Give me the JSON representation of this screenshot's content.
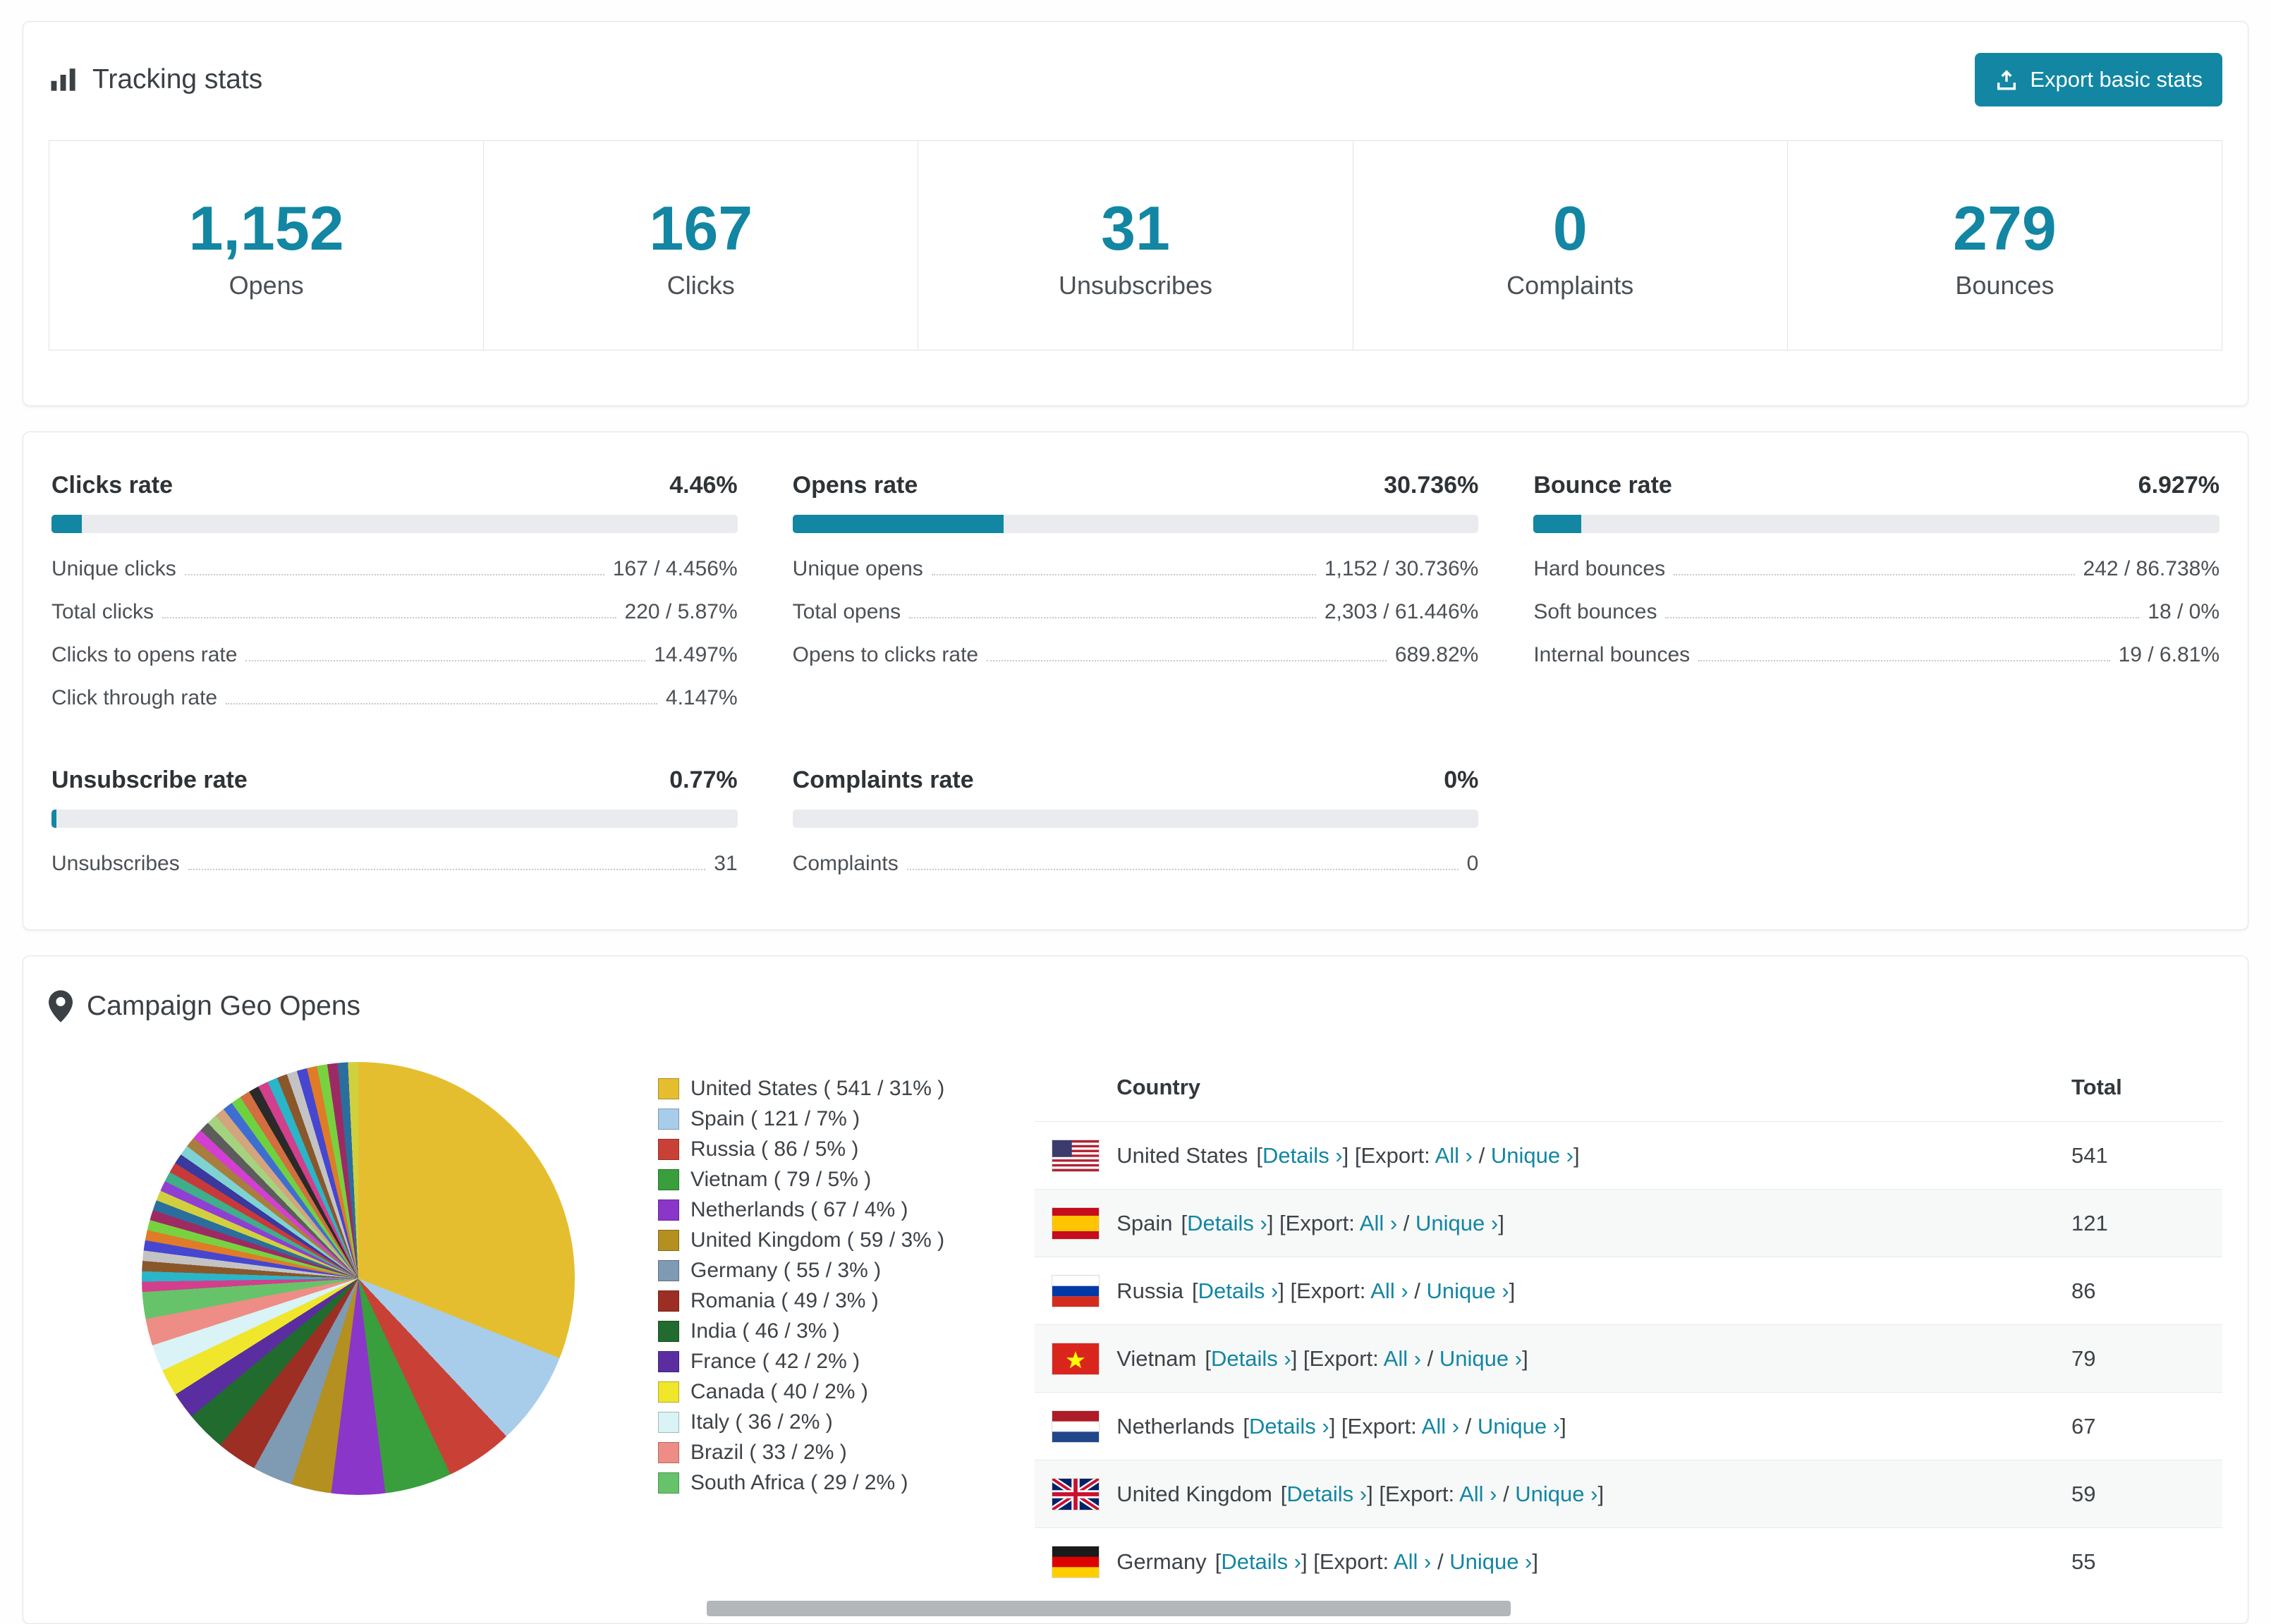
{
  "colors": {
    "accent": "#1286a3",
    "progress_track": "#e9ebee",
    "card_border": "#e3e4e5",
    "scrollbar": "#b4b7ba"
  },
  "tracking": {
    "title": "Tracking stats",
    "export_button": "Export basic stats",
    "stats": [
      {
        "value": "1,152",
        "label": "Opens"
      },
      {
        "value": "167",
        "label": "Clicks"
      },
      {
        "value": "31",
        "label": "Unsubscribes"
      },
      {
        "value": "0",
        "label": "Complaints"
      },
      {
        "value": "279",
        "label": "Bounces"
      }
    ]
  },
  "rates": [
    {
      "title": "Clicks rate",
      "value": "4.46%",
      "pct": 4.46,
      "rows": [
        {
          "label": "Unique clicks",
          "value": "167 / 4.456%"
        },
        {
          "label": "Total clicks",
          "value": "220 / 5.87%"
        },
        {
          "label": "Clicks to opens rate",
          "value": "14.497%"
        },
        {
          "label": "Click through rate",
          "value": "4.147%"
        }
      ]
    },
    {
      "title": "Opens rate",
      "value": "30.736%",
      "pct": 30.736,
      "rows": [
        {
          "label": "Unique opens",
          "value": "1,152 / 30.736%"
        },
        {
          "label": "Total opens",
          "value": "2,303 / 61.446%"
        },
        {
          "label": "Opens to clicks rate",
          "value": "689.82%"
        }
      ]
    },
    {
      "title": "Bounce rate",
      "value": "6.927%",
      "pct": 6.927,
      "rows": [
        {
          "label": "Hard bounces",
          "value": "242 / 86.738%"
        },
        {
          "label": "Soft bounces",
          "value": "18 / 0%"
        },
        {
          "label": "Internal bounces",
          "value": "19 / 6.81%"
        }
      ]
    },
    {
      "title": "Unsubscribe rate",
      "value": "0.77%",
      "pct": 0.77,
      "rows": [
        {
          "label": "Unsubscribes",
          "value": "31"
        }
      ]
    },
    {
      "title": "Complaints rate",
      "value": "0%",
      "pct": 0,
      "rows": [
        {
          "label": "Complaints",
          "value": "0"
        }
      ]
    }
  ],
  "geo": {
    "title": "Campaign Geo Opens",
    "chart_data": {
      "type": "pie",
      "title": "Campaign Geo Opens",
      "legend_position": "right",
      "slices": [
        {
          "label": "United States",
          "value": 541,
          "pct": 31,
          "color": "#e5be2f"
        },
        {
          "label": "Spain",
          "value": 121,
          "pct": 7,
          "color": "#a8cdea"
        },
        {
          "label": "Russia",
          "value": 86,
          "pct": 5,
          "color": "#c94136"
        },
        {
          "label": "Vietnam",
          "value": 79,
          "pct": 5,
          "color": "#399e3c"
        },
        {
          "label": "Netherlands",
          "value": 67,
          "pct": 4,
          "color": "#8a36c9"
        },
        {
          "label": "United Kingdom",
          "value": 59,
          "pct": 3,
          "color": "#b39020"
        },
        {
          "label": "Germany",
          "value": 55,
          "pct": 3,
          "color": "#7f9ab3"
        },
        {
          "label": "Romania",
          "value": 49,
          "pct": 3,
          "color": "#9c2e24"
        },
        {
          "label": "India",
          "value": 46,
          "pct": 3,
          "color": "#206b2d"
        },
        {
          "label": "France",
          "value": 42,
          "pct": 2,
          "color": "#5a2ea0"
        },
        {
          "label": "Canada",
          "value": 40,
          "pct": 2,
          "color": "#f0e62c"
        },
        {
          "label": "Italy",
          "value": 36,
          "pct": 2,
          "color": "#d9f3f6"
        },
        {
          "label": "Brazil",
          "value": 33,
          "pct": 2,
          "color": "#ee8d85"
        },
        {
          "label": "South Africa",
          "value": 29,
          "pct": 2,
          "color": "#66c36a"
        }
      ],
      "others_pct": 26,
      "others_palette": [
        "#d23f8c",
        "#2ab5c8",
        "#8a572a",
        "#c3c3c3",
        "#4646d0",
        "#e07b28",
        "#78d23f",
        "#9e2a63",
        "#2a6e9e",
        "#d2cf3f",
        "#8f3fd2",
        "#3fae8a",
        "#c83a3a",
        "#39399e",
        "#7fd2d2",
        "#a87e3f",
        "#d23fd2",
        "#5c5c5c",
        "#a5d27f",
        "#d2a57f",
        "#3f6ed2",
        "#6ed23f",
        "#d26e3f",
        "#2a2a2a"
      ]
    },
    "table": {
      "headers": [
        "Country",
        "Total"
      ],
      "link_parts": {
        "open": "[",
        "details": "Details ›",
        "mid": "] [Export: ",
        "all": "All ›",
        "sep": " / ",
        "unique": "Unique ›",
        "close": "]"
      },
      "rows": [
        {
          "country": "United States",
          "flag": "us",
          "total": "541"
        },
        {
          "country": "Spain",
          "flag": "es",
          "total": "121"
        },
        {
          "country": "Russia",
          "flag": "ru",
          "total": "86"
        },
        {
          "country": "Vietnam",
          "flag": "vn",
          "total": "79"
        },
        {
          "country": "Netherlands",
          "flag": "nl",
          "total": "67"
        },
        {
          "country": "United Kingdom",
          "flag": "gb",
          "total": "59"
        },
        {
          "country": "Germany",
          "flag": "de",
          "total": "55"
        }
      ]
    }
  }
}
